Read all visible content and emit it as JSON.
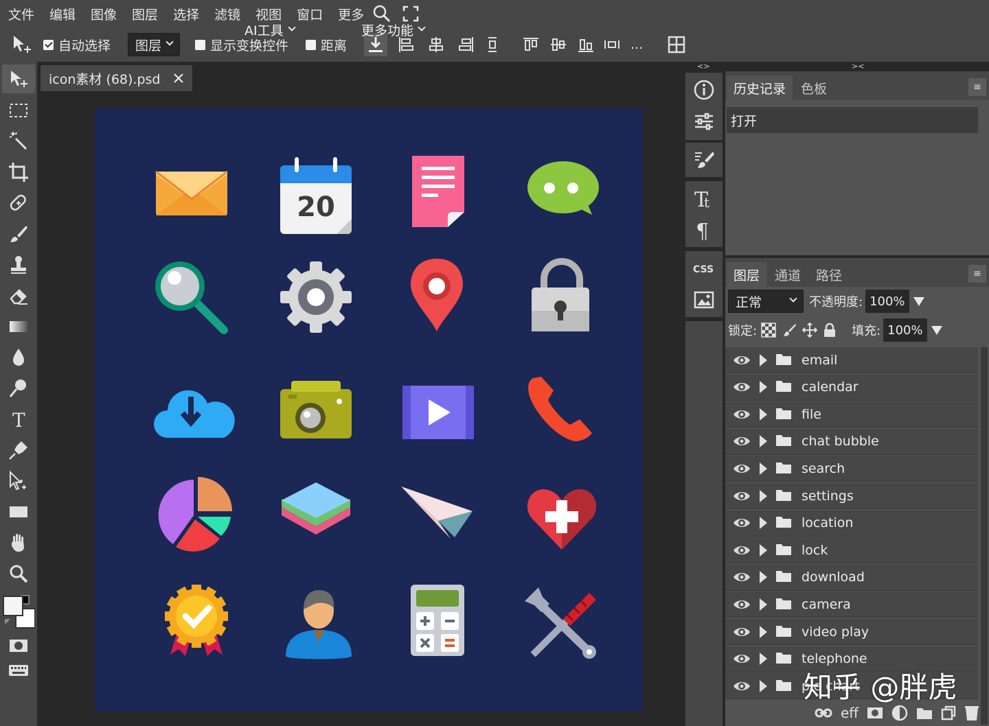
{
  "menubar": {
    "items": [
      "文件",
      "编辑",
      "图像",
      "图层",
      "选择",
      "滤镜",
      "视图",
      "窗口",
      "更多"
    ],
    "ai_tools": "AI工具",
    "more_features": "更多功能"
  },
  "options": {
    "auto_select_label": "自动选择",
    "auto_select_checked": true,
    "target_value": "图层",
    "show_transform_label": "显示变换控件",
    "distance_label": "距离",
    "more_label": "..."
  },
  "document": {
    "tab_title": "icon素材 (68).psd"
  },
  "history_panel": {
    "tabs": [
      "历史记录",
      "色板"
    ],
    "items": [
      "打开"
    ]
  },
  "layers_panel": {
    "tabs": [
      "图层",
      "通道",
      "路径"
    ],
    "blend_mode": "正常",
    "opacity_label": "不透明度:",
    "opacity_value": "100%",
    "lock_label": "锁定:",
    "fill_label": "填充:",
    "fill_value": "100%",
    "layers": [
      "email",
      "calendar",
      "file",
      "chat bubble",
      "search",
      "settings",
      "location",
      "lock",
      "download",
      "camera",
      "video play",
      "telephone",
      "pie chart"
    ]
  },
  "canvas_icons": {
    "calendar_date": "20"
  },
  "watermark": "知乎 @胖虎",
  "colors": {
    "menubar_bg": "#474747",
    "workspace_bg": "#282828",
    "canvas_bg": "#1b2755",
    "panel_bg": "#535353"
  }
}
